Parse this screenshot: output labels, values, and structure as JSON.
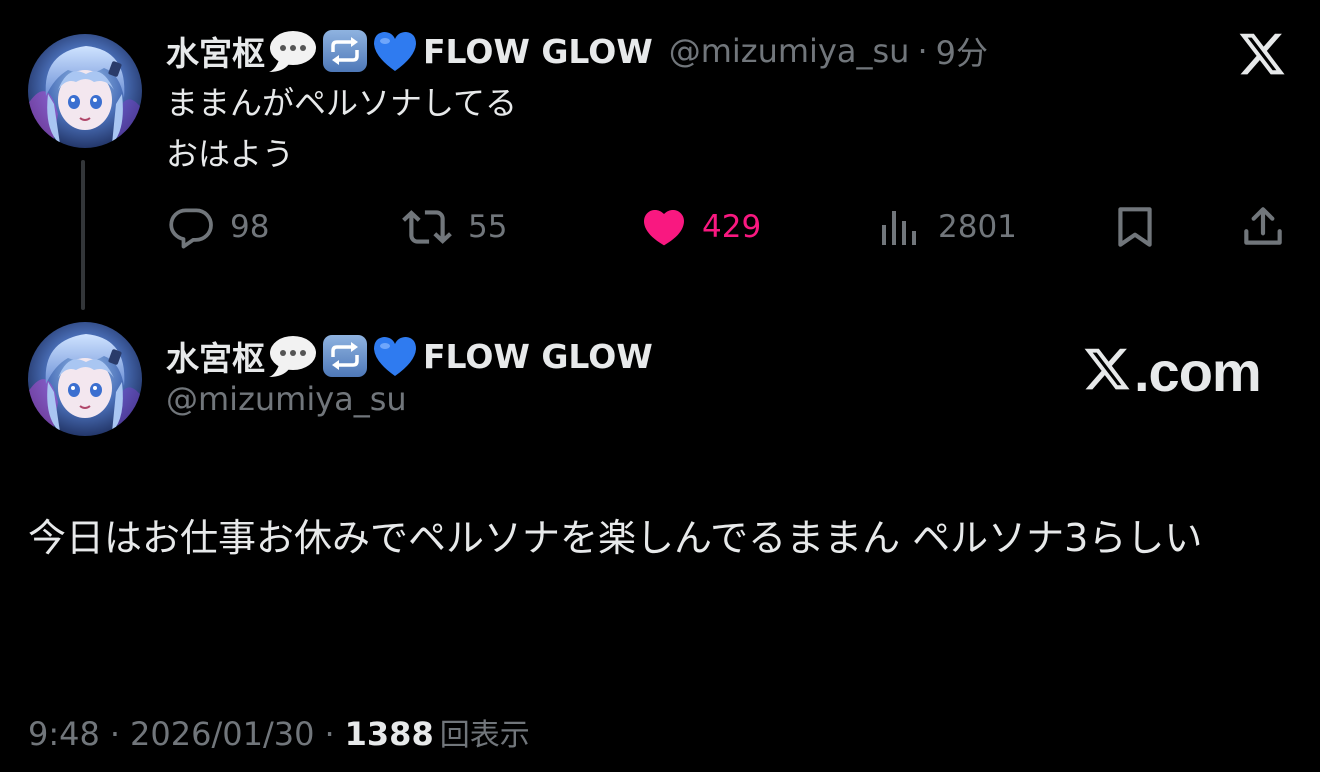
{
  "reply": {
    "display_name": "水宮枢",
    "brand": "FLOW GLOW",
    "handle": "@mizumiya_su",
    "separator": "·",
    "time_ago": "9分",
    "text_lines": [
      "ままんがペルソナしてる",
      "おはよう"
    ],
    "actions": {
      "replies": "98",
      "retweets": "55",
      "likes": "429",
      "views": "2801"
    }
  },
  "main": {
    "display_name": "水宮枢",
    "brand": "FLOW GLOW",
    "handle": "@mizumiya_su",
    "text": "今日はお仕事お休みでペルソナを楽しんでるままん ペルソナ3らしい",
    "time": "9:48",
    "date": "2026/01/30",
    "separator": "·",
    "views_count": "1388",
    "views_label": "回表示"
  },
  "watermark": {
    "domain_suffix": ".com"
  },
  "icons": {
    "emojis": [
      "speech-balloon-icon",
      "repeat-button-icon",
      "blue-heart-icon"
    ],
    "actions": [
      "reply-icon",
      "retweet-icon",
      "heart-icon",
      "views-icon",
      "bookmark-icon",
      "share-icon"
    ],
    "logo": "x-logo-icon"
  },
  "colors": {
    "background": "#000000",
    "text_primary": "#e7e9ea",
    "text_secondary": "#71767b",
    "like_pink": "#f91880",
    "thread_line": "#333639"
  }
}
